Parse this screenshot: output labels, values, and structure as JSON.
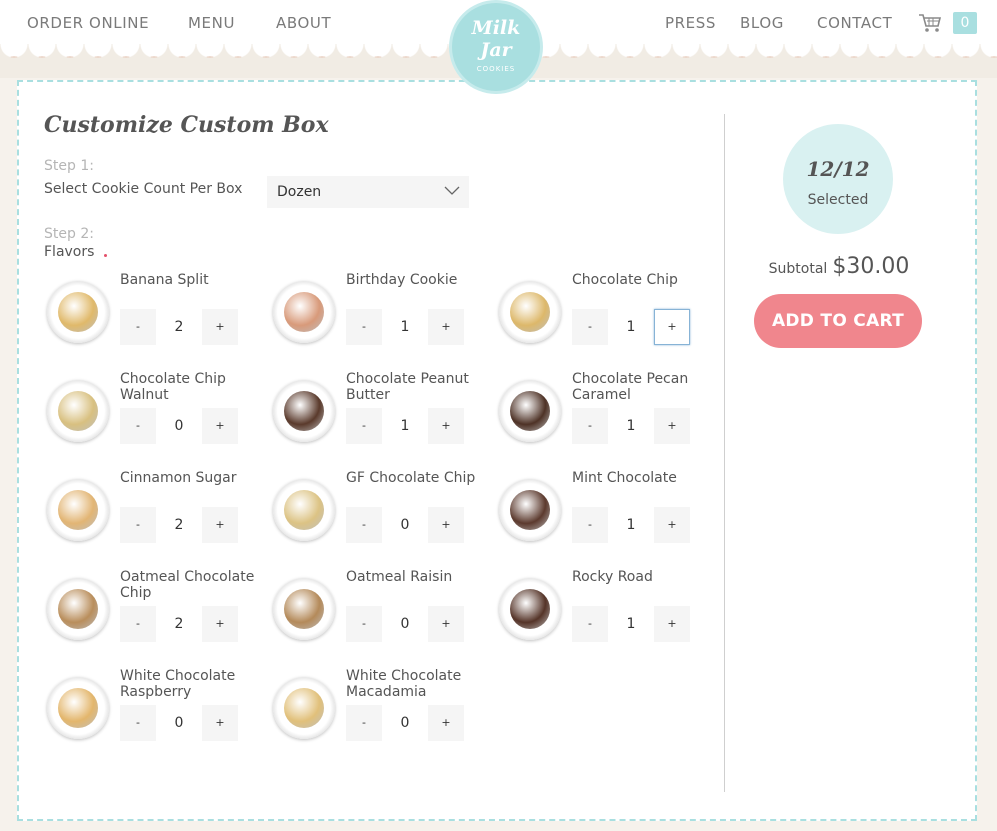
{
  "nav": {
    "left": [
      "ORDER ONLINE",
      "MENU",
      "ABOUT"
    ],
    "right": [
      "PRESS",
      "BLOG",
      "CONTACT"
    ],
    "cart_count": "0",
    "logo": {
      "line1": "Milk",
      "line2": "Jar",
      "line3": "COOKIES"
    }
  },
  "page": {
    "title": "Customize Custom Box",
    "step1_label": "Step 1:",
    "step1_text": "Select Cookie Count Per Box",
    "box_size_selected": "Dozen",
    "step2_label": "Step 2:",
    "step2_text": "Flavors"
  },
  "flavors": [
    {
      "name": "Banana Split",
      "qty": "2",
      "color": "#e0b96a"
    },
    {
      "name": "Birthday Cookie",
      "qty": "1",
      "color": "#d89a7a"
    },
    {
      "name": "Chocolate Chip",
      "qty": "1",
      "color": "#ddb86a"
    },
    {
      "name": "Chocolate Chip Walnut",
      "qty": "0",
      "color": "#d8c080"
    },
    {
      "name": "Chocolate Peanut Butter",
      "qty": "1",
      "color": "#5a3a2c"
    },
    {
      "name": "Chocolate Pecan Caramel",
      "qty": "1",
      "color": "#4e3226"
    },
    {
      "name": "Cinnamon Sugar",
      "qty": "2",
      "color": "#e2b574"
    },
    {
      "name": "GF Chocolate Chip",
      "qty": "0",
      "color": "#dcc384"
    },
    {
      "name": "Mint Chocolate",
      "qty": "1",
      "color": "#5c3a2e"
    },
    {
      "name": "Oatmeal Chocolate Chip",
      "qty": "2",
      "color": "#b98e5c"
    },
    {
      "name": "Oatmeal Raisin",
      "qty": "0",
      "color": "#b48a5a"
    },
    {
      "name": "Rocky Road",
      "qty": "1",
      "color": "#553428"
    },
    {
      "name": "White Chocolate Raspberry",
      "qty": "0",
      "color": "#e3b66c"
    },
    {
      "name": "White Chocolate Macadamia",
      "qty": "0",
      "color": "#e1c07a"
    }
  ],
  "controls": {
    "minus": "-",
    "plus": "+"
  },
  "summary": {
    "count": "12/12",
    "selected_label": "Selected",
    "subtotal_label": "Subtotal",
    "subtotal_value": "$30.00",
    "add_to_cart": "ADD TO CART"
  },
  "colors": {
    "accent_teal": "#a9dfe0",
    "button_pink": "#f0868d"
  },
  "icons": [
    "cart-icon",
    "chevron-down-icon"
  ]
}
